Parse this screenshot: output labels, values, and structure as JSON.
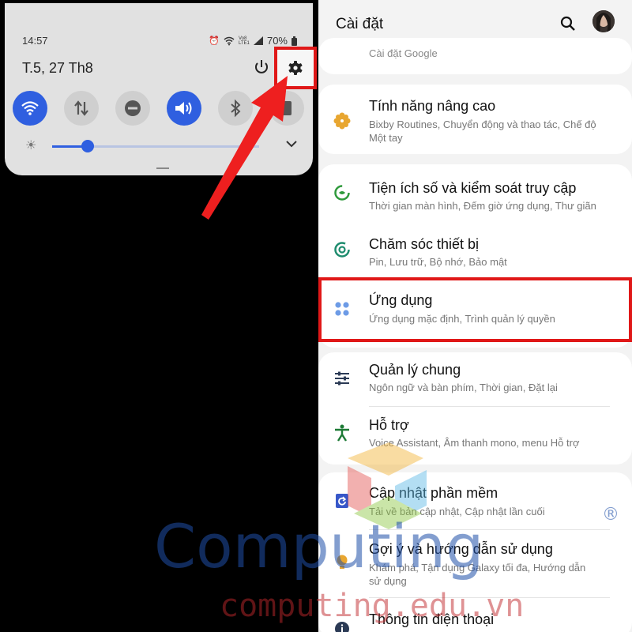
{
  "quick_panel": {
    "time": "14:57",
    "battery": "70%",
    "net_label": "Vo8 LTE1",
    "date": "T.5, 27 Th8",
    "brightness_level": 0.17
  },
  "settings": {
    "title": "Cài đặt",
    "partial_item": "Cài đặt Google",
    "items": [
      {
        "title": "Tính năng nâng cao",
        "subtitle": "Bixby Routines, Chuyển động và thao tác, Chế độ Một tay"
      },
      {
        "title": "Tiện ích số và kiểm soát truy cập",
        "subtitle": "Thời gian màn hình, Đếm giờ ứng dụng, Thư giãn"
      },
      {
        "title": "Chăm sóc thiết bị",
        "subtitle": "Pin, Lưu trữ, Bộ nhớ, Bảo mật"
      },
      {
        "title": "Ứng dụng",
        "subtitle": "Ứng dụng mặc định, Trình quản lý quyền"
      },
      {
        "title": "Quản lý chung",
        "subtitle": "Ngôn ngữ và bàn phím, Thời gian, Đặt lại"
      },
      {
        "title": "Hỗ trợ",
        "subtitle": "Voice Assistant, Âm thanh mono, menu Hỗ trợ"
      },
      {
        "title": "Cập nhật phần mềm",
        "subtitle": "Tải về bản cập nhật, Cập nhật lần cuối"
      },
      {
        "title": "Gợi ý và hướng dẫn sử dụng",
        "subtitle": "Khám phá, Tận dụng Galaxy tối đa, Hướng dẫn sử dụng"
      },
      {
        "title": "Thông tin điện thoại",
        "subtitle": ""
      }
    ]
  },
  "watermark": {
    "brand": "Computing",
    "registered": "®",
    "url": "computing.edu.vn"
  },
  "colors": {
    "accent_blue": "#2f5fe0",
    "highlight_red": "#e01818",
    "watermark_blue": "#1f4fa8",
    "watermark_red": "#c0282c"
  }
}
